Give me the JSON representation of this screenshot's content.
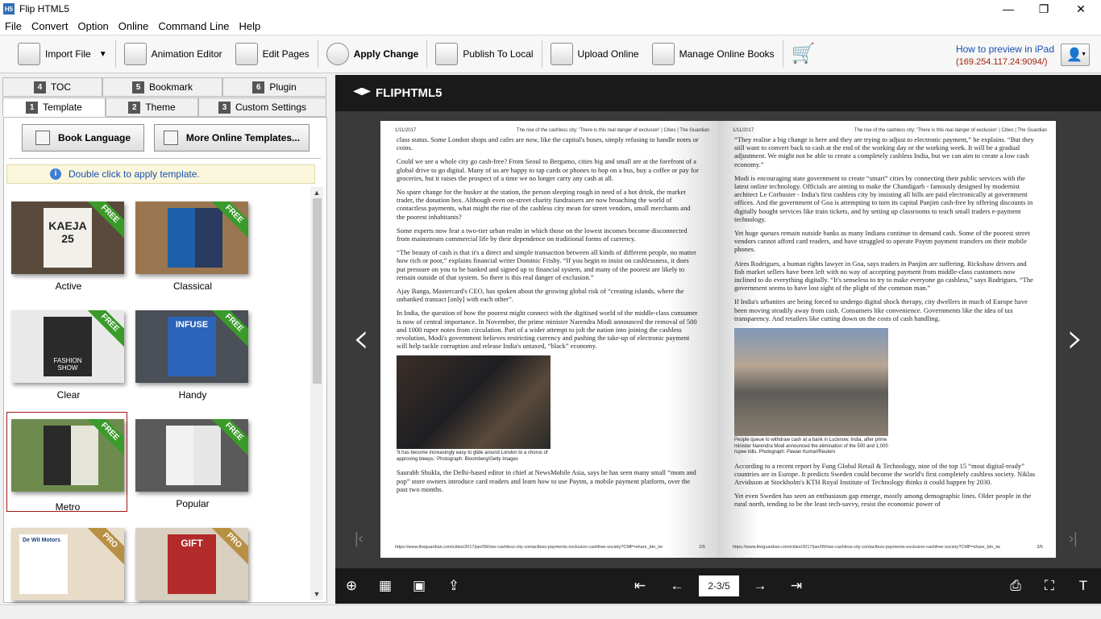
{
  "app": {
    "title": "Flip HTML5",
    "icon_text": "H5"
  },
  "window_controls": {
    "minimize": "—",
    "restore": "❐",
    "close": "✕"
  },
  "menu": [
    "File",
    "Convert",
    "Option",
    "Online",
    "Command Line",
    "Help"
  ],
  "toolbar": {
    "import_file": "Import File",
    "animation_editor": "Animation Editor",
    "edit_pages": "Edit Pages",
    "apply_change": "Apply Change",
    "publish_local": "Publish To Local",
    "upload_online": "Upload Online",
    "manage_online": "Manage Online Books",
    "preview_link": "How to preview in iPad",
    "preview_ip": "(169.254.117.24:9094/)"
  },
  "tabs_top": [
    {
      "num": "4",
      "label": "TOC"
    },
    {
      "num": "5",
      "label": "Bookmark"
    },
    {
      "num": "6",
      "label": "Plugin"
    }
  ],
  "tabs_bottom": [
    {
      "num": "1",
      "label": "Template"
    },
    {
      "num": "2",
      "label": "Theme"
    },
    {
      "num": "3",
      "label": "Custom Settings"
    }
  ],
  "panel": {
    "book_language": "Book Language",
    "more_templates": "More Online Templates...",
    "info": "Double click to apply template."
  },
  "templates": [
    {
      "name": "Active",
      "badge": "FREE",
      "bg": "#5a4a3c",
      "cover_text": "KAEJA 25"
    },
    {
      "name": "Classical",
      "badge": "FREE",
      "bg": "#8a6a48",
      "cover_text": ""
    },
    {
      "name": "Clear",
      "badge": "FREE",
      "bg": "#e9e9e9",
      "cover_text": "FASHION SHOW"
    },
    {
      "name": "Handy",
      "badge": "FREE",
      "bg": "#4a4f58",
      "cover_text": "INFUSE"
    },
    {
      "name": "Metro",
      "badge": "FREE",
      "bg": "#6e8b4e",
      "cover_text": ""
    },
    {
      "name": "Popular",
      "badge": "FREE",
      "bg": "#5a5a5a",
      "cover_text": ""
    },
    {
      "name": "",
      "badge": "PRO",
      "bg": "#e6dcc8",
      "cover_text": "De Wit Motors"
    },
    {
      "name": "",
      "badge": "PRO",
      "bg": "#d8cfc0",
      "cover_text": "GIFT"
    }
  ],
  "colors": {
    "free_badge": "#3a9a2a",
    "pro_badge": "#b89044"
  },
  "viewer": {
    "logo": "FLIPHTML5",
    "page_indicator": "2-3/5",
    "left_page": {
      "header_left": "1/11/2017",
      "header_right": "The rise of the cashless city: 'There is this real danger of exclusion' | Cities | The Guardian",
      "paragraphs": [
        "class status. Some London shops and cafes are now, like the capital's buses, simply refusing to handle notes or coins.",
        "Could we see a whole city go cash-free? From Seoul to Bergamo, cities big and small are at the forefront of a global drive to go digital. Many of us are happy to tap cards or phones to hop on a bus, buy a coffee or pay for groceries, but it raises the prospect of a time we no longer carry any cash at all.",
        "No spare change for the busker at the station, the person sleeping rough in need of a hot drink, the market trader, the donation box. Although even on-street charity fundraisers are now broaching the world of contactless payments, what might the rise of the cashless city mean for street vendors, small merchants and the poorest inhabitants?",
        "Some experts now fear a two-tier urban realm in which those on the lowest incomes become disconnected from mainstream commercial life by their dependence on traditional forms of currency.",
        "“The beauty of cash is that it's a direct and simple transaction between all kinds of different people, no matter how rich or poor,” explains financial writer Dominic Frisby. “If you begin to insist on cashlessness, it does put pressure on you to be banked and signed up to financial system, and many of the poorest are likely to remain outside of that system. So there is this real danger of exclusion.”",
        "Ajay Banga, Mastercard's CEO, has spoken about the growing global risk of “creating islands, where the unbanked transact [only] with each other”.",
        "In India, the question of how the poorest might connect with the digitised world of the middle-class consumer is now of central importance. In November, the prime minister Narendra Modi announced the removal of 500 and 1000 rupee notes from circulation. Part of a wider attempt to jolt the nation into joining the cashless revolution, Modi's government believes restricting currency and pushing the take-up of electronic payment will help tackle corruption and release India's untaxed, “black” economy."
      ],
      "caption": "'It has become increasingly easy to glide around London to a chorus of approving bleeps.' Photograph: Bloomberg/Getty Images",
      "after_photo": "Saurabh Shukla, the Delhi-based editor in chief at NewsMobile Asia, says he has seen many small “mom and pop” store owners introduce card readers and learn how to use Paytm, a mobile payment platform, over the past two months.",
      "footer_url": "https://www.theguardian.com/cities/2017/jan/09/rise-cashless-city-contactless-payments-exclusion-cashfree-society?CMP=share_btn_tw",
      "footer_num": "2/5"
    },
    "right_page": {
      "header_left": "1/11/2017",
      "header_right": "The rise of the cashless city: 'There is this real danger of exclusion' | Cities | The Guardian",
      "paragraphs": [
        "“They realise a big change is here and they are trying to adjust to electronic payment,” he explains. “But they still want to convert back to cash at the end of the working day or the working week. It will be a gradual adjustment. We might not be able to create a completely cashless India, but we can aim to create a low cash economy.”",
        "Modi is encouraging state government to create “smart” cities by connecting their public services with the latest online technology. Officials are aiming to make the Chandigarh - famously designed by modernist architect Le Corbusier - India's first cashless city by insisting all bills are paid electronically at government offices. And the government of Goa is attempting to turn its capital Panjim cash-free by offering discounts in digitally bought services like train tickets, and by setting up classrooms to teach small traders e-payment technology.",
        "Yet huge queues remain outside banks as many Indians continue to demand cash. Some of the poorest street vendors cannot afford card readers, and have struggled to operate Paytm payment transfers on their mobile phones.",
        "Aires Rodrigues, a human rights lawyer in Goa, says traders in Panjim are suffering. Rickshaw drivers and fish market sellers have been left with no way of accepting payment from middle-class customers now inclined to do everything digitally. “It's senseless to try to make everyone go cashless,” says Rodrigues. “The government seems to have lost sight of the plight of the common man.”",
        "If India's urbanites are being forced to undergo digital shock therapy, city dwellers in much of Europe have been moving steadily away from cash. Consumers like convenience. Governments like the idea of tax transparency. And retailers like cutting down on the costs of cash handling."
      ],
      "caption": "People queue to withdraw cash at a bank in Lucknow, India, after prime minister Narendra Modi announced the elimination of the 500 and 1,000 rupee bills. Photograph: Pawan Kumar/Reuters",
      "after_photo": [
        "According to a recent report by Fung Global Retail & Technology, nine of the top 15 “most digital-ready” countries are in Europe. It predicts Sweden could become the world's first completely cashless society. Niklas Arvidsson at Stockholm's KTH Royal Institute of Technology thinks it could happen by 2030.",
        "Yet even Sweden has seen an enthusiasm gap emerge, mostly among demographic lines. Older people in the rural north, tending to be the least tech-savvy, resist the economic power of"
      ],
      "footer_url": "https://www.theguardian.com/cities/2017/jan/09/rise-cashless-city-contactless-payments-exclusion-cashfree-society?CMP=share_btn_tw",
      "footer_num": "3/5"
    }
  }
}
